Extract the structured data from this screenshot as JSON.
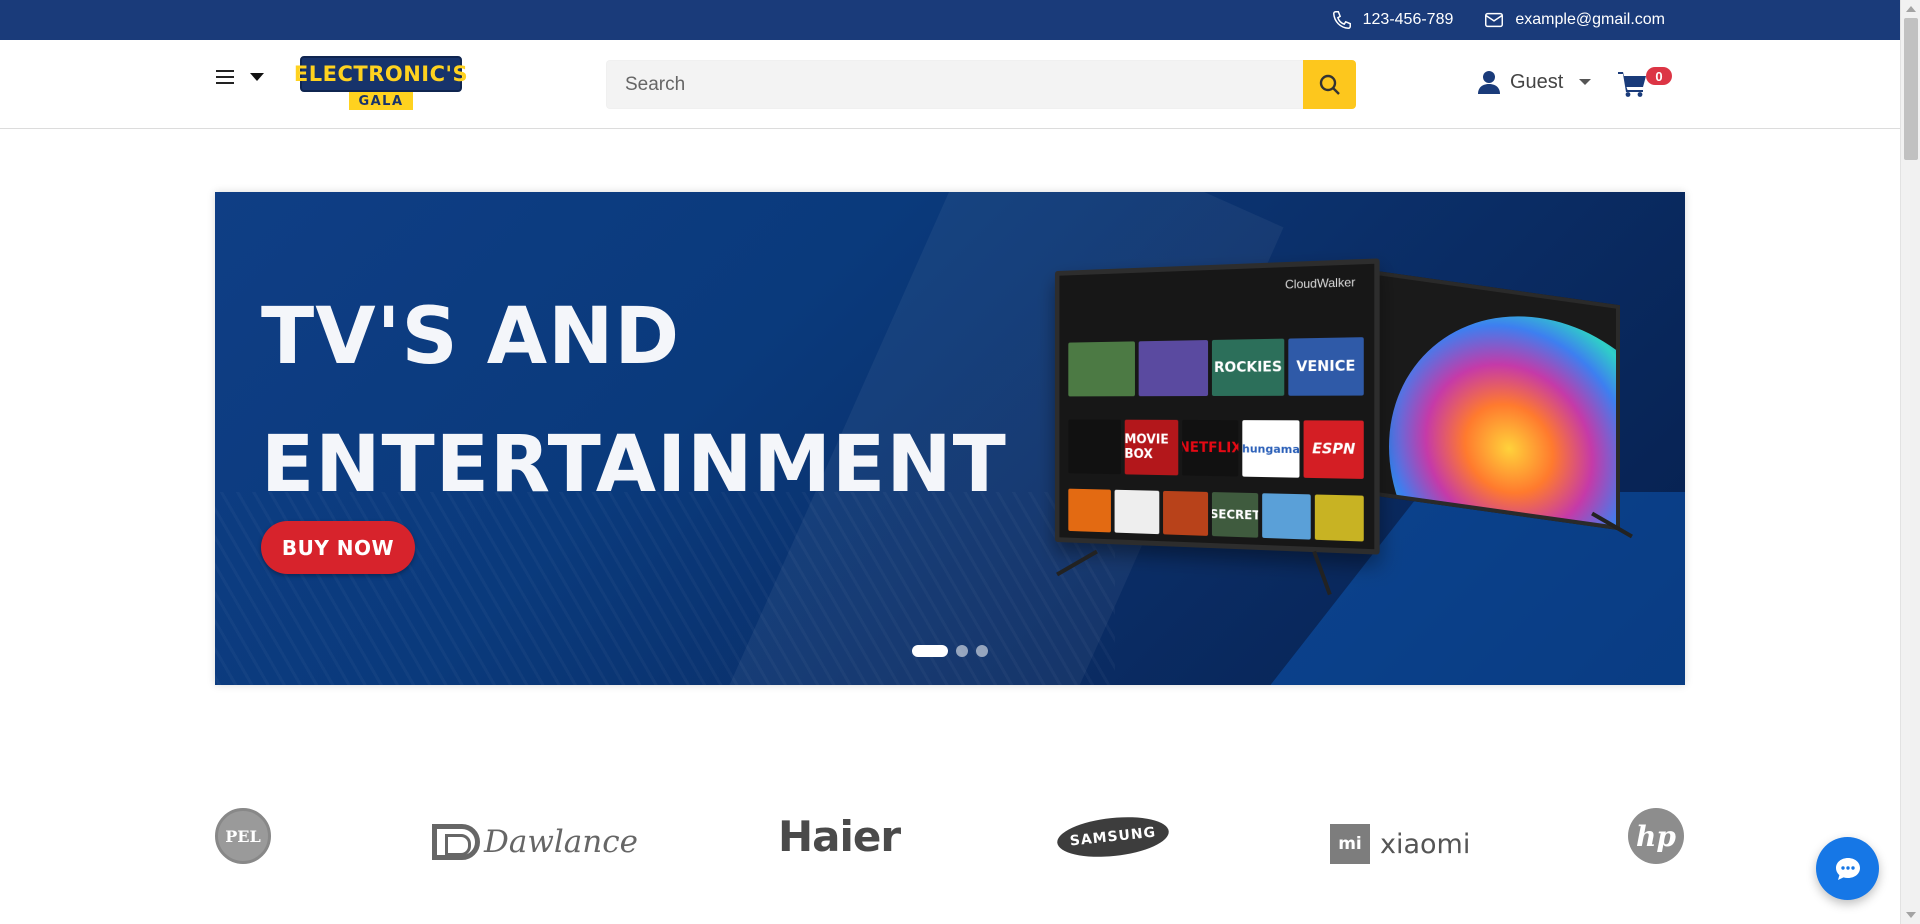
{
  "topbar": {
    "phone": "123-456-789",
    "email": "example@gmail.com"
  },
  "header": {
    "logo_top": "ELECTRONIC'S",
    "logo_bottom": "GALA",
    "search_placeholder": "Search",
    "account_label": "Guest",
    "cart_count": "0"
  },
  "hero": {
    "title_line1": "TV'S AND",
    "title_line2": "ENTERTAINMENT",
    "cta_label": "BUY NOW",
    "tv_brand": "CloudWalker",
    "tiles_row1": [
      "",
      "",
      "ROCKIES",
      "VENICE"
    ],
    "tiles_row2": [
      "",
      "MOVIE BOX",
      "NETFLIX",
      "hungama",
      "ESPN"
    ],
    "tiles_row3": [
      "",
      "",
      "",
      "SECRET",
      "",
      ""
    ],
    "slides_total": 3,
    "active_slide": 1
  },
  "brands": {
    "pel": "PEL",
    "dawlance": "Dawlance",
    "haier": "Haier",
    "samsung": "SAMSUNG",
    "xiaomi_mark": "mi",
    "xiaomi": "xiaomi",
    "hp": "hp"
  },
  "colors": {
    "topbar_bg": "#1a3b7a",
    "search_button": "#fdc71d",
    "cart_badge": "#dc3545",
    "cta": "#d7232c",
    "chat_button": "#1677e6"
  }
}
